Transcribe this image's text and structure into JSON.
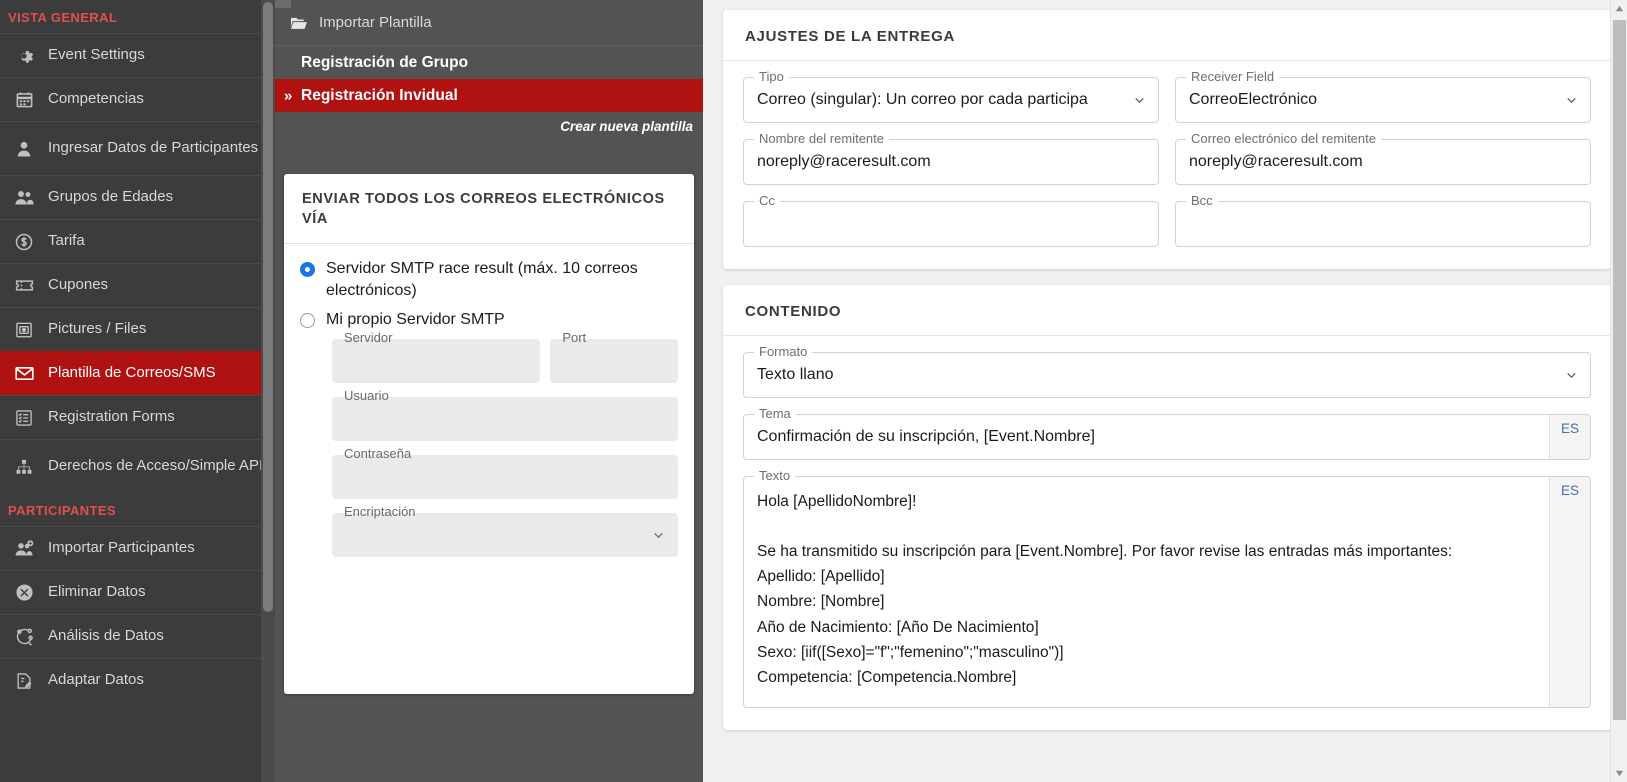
{
  "sidebar": {
    "sections": [
      {
        "title": "VISTA GENERAL",
        "items": [
          {
            "label": "Event Settings",
            "icon": "gear-icon",
            "active": false
          },
          {
            "label": "Competencias",
            "icon": "calendar-icon",
            "active": false
          },
          {
            "label": "Ingresar Datos de Participantes",
            "icon": "person-icon",
            "active": false
          },
          {
            "label": "Grupos de Edades",
            "icon": "people-icon",
            "active": false
          },
          {
            "label": "Tarifa",
            "icon": "dollar-coin-icon",
            "active": false
          },
          {
            "label": "Cupones",
            "icon": "ticket-icon",
            "active": false
          },
          {
            "label": "Pictures / Files",
            "icon": "picture-icon",
            "active": false
          },
          {
            "label": "Plantilla de Correos/SMS",
            "icon": "envelope-icon",
            "active": true
          },
          {
            "label": "Registration Forms",
            "icon": "form-list-icon",
            "active": false
          },
          {
            "label": "Derechos de Acceso/Simple API",
            "icon": "sitemap-icon",
            "active": false
          }
        ]
      },
      {
        "title": "PARTICIPANTES",
        "items": [
          {
            "label": "Importar Participantes",
            "icon": "add-people-icon",
            "active": false
          },
          {
            "label": "Eliminar Datos",
            "icon": "delete-circle-icon",
            "active": false
          },
          {
            "label": "Análisis de Datos",
            "icon": "analysis-icon",
            "active": false
          },
          {
            "label": "Adaptar Datos",
            "icon": "edit-document-icon",
            "active": false
          }
        ]
      }
    ]
  },
  "midpanel": {
    "import_template_label": "Importar Plantilla",
    "templates": [
      {
        "label": "Registración de Grupo",
        "active": false
      },
      {
        "label": "Registración Invidual",
        "active": true
      }
    ],
    "create_new_label": "Crear nueva plantilla",
    "smtp": {
      "title": "ENVIAR TODOS LOS CORREOS ELECTRÓNICOS VÍA",
      "options": [
        {
          "label": "Servidor SMTP race result (máx. 10 correos electrónicos)",
          "checked": true
        },
        {
          "label": "Mi propio Servidor SMTP",
          "checked": false
        }
      ],
      "fields": {
        "server_label": "Servidor",
        "server_value": "",
        "port_label": "Port",
        "port_value": "",
        "user_label": "Usuario",
        "user_value": "",
        "password_label": "Contraseña",
        "password_value": "",
        "encryption_label": "Encriptación",
        "encryption_value": ""
      }
    }
  },
  "delivery": {
    "title": "AJUSTES DE LA ENTREGA",
    "tipo_label": "Tipo",
    "tipo_value": "Correo (singular): Un correo por cada participa",
    "receiver_label": "Receiver Field",
    "receiver_value": "CorreoElectrónico",
    "sender_name_label": "Nombre del remitente",
    "sender_name_value": "noreply@raceresult.com",
    "sender_email_label": "Correo electrónico del remitente",
    "sender_email_value": "noreply@raceresult.com",
    "cc_label": "Cc",
    "cc_value": "",
    "bcc_label": "Bcc",
    "bcc_value": ""
  },
  "content": {
    "title": "CONTENIDO",
    "formato_label": "Formato",
    "formato_value": "Texto llano",
    "tema_label": "Tema",
    "tema_value": "Confirmación de su inscripción, [Event.Nombre]",
    "tema_lang": "ES",
    "texto_label": "Texto",
    "texto_lang": "ES",
    "texto_value": "Hola [ApellidoNombre]!\n\nSe ha transmitido su inscripción para [Event.Nombre]. Por favor revise las entradas más importantes:\nApellido: [Apellido]\nNombre: [Nombre]\nAño de Nacimiento: [Año De Nacimiento]\nSexo: [iif([Sexo]=\"f\";\"femenino\";\"masculino\")]\nCompetencia: [Competencia.Nombre]"
  },
  "colors": {
    "accent_red": "#b01212",
    "section_heading_red": "#e05050",
    "sidebar_bg": "#3c3c3c",
    "midpanel_bg": "#535353",
    "radio_blue": "#1a73e8",
    "lang_tab_blue": "#4a6ea9"
  }
}
